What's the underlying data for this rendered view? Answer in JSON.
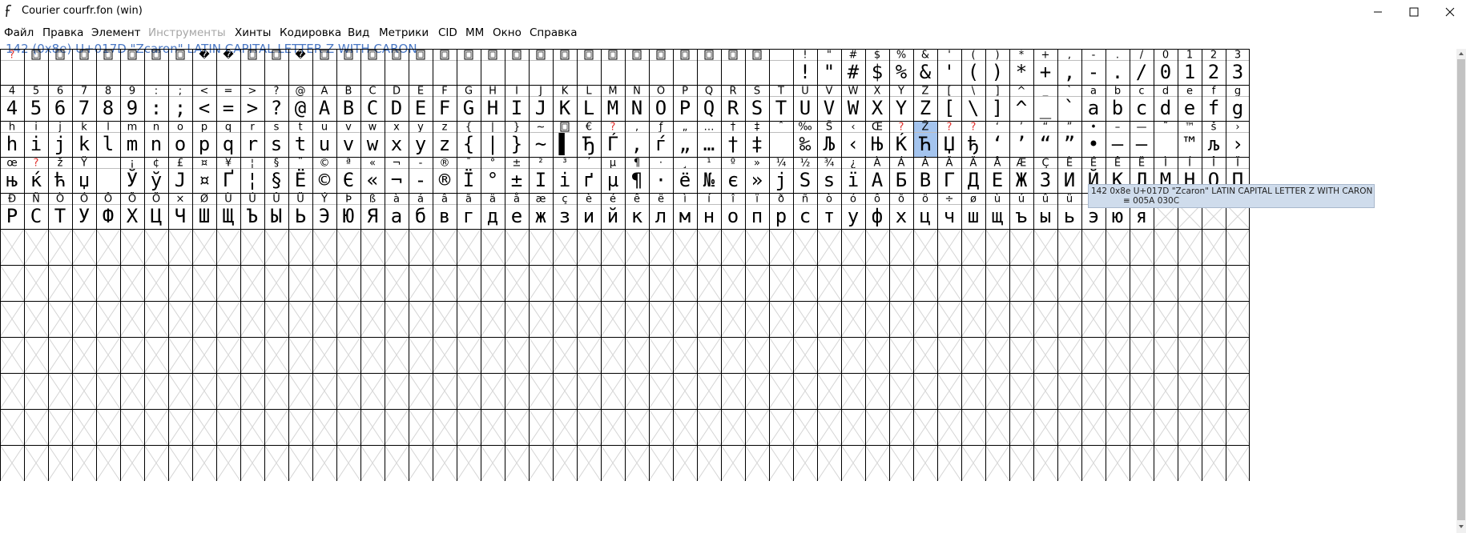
{
  "window": {
    "title": "Courier courfr.fon (win)"
  },
  "menu": [
    {
      "label": "Файл",
      "enabled": true
    },
    {
      "label": "Правка",
      "enabled": true
    },
    {
      "label": "Элемент",
      "enabled": true
    },
    {
      "label": "Инструменты",
      "enabled": false
    },
    {
      "label": "Хинты",
      "enabled": true
    },
    {
      "label": "Кодировка",
      "enabled": true
    },
    {
      "label": "Вид",
      "enabled": true
    },
    {
      "label": "Метрики",
      "enabled": true
    },
    {
      "label": "CID",
      "enabled": true
    },
    {
      "label": "MM",
      "enabled": true
    },
    {
      "label": "Окно",
      "enabled": true
    },
    {
      "label": "Справка",
      "enabled": true
    }
  ],
  "glyph_info": "142 (0x8e) U+017D \"Zcaron\" LATIN CAPITAL LETTER Z WITH CARON",
  "tooltip": {
    "line1": "142 0x8e U+017D \"Zcaron\" LATIN CAPITAL LETTER Z WITH CARON",
    "line2": "≡ 005A 030C"
  },
  "selected_index": 142,
  "colors": {
    "accent": "#4a78c4",
    "missing": "#e0302c",
    "selection": "#a4c4ee",
    "grid": "#000000",
    "empty_cross": "#d4d4d4"
  },
  "rows": [
    {
      "labels": [
        "?",
        "⌂",
        "⌂",
        "⌂",
        "⌂",
        "⌂",
        "⌂",
        "⌂",
        "�",
        "�",
        "⌂",
        "⌂",
        "�",
        "⌂",
        "⌂",
        "⌂",
        "⌂",
        "⌂",
        "⌂",
        "⌂",
        "⌂",
        "⌂",
        "⌂",
        "⌂",
        "⌂",
        "⌂",
        "⌂",
        "⌂",
        "⌂",
        "⌂",
        "⌂",
        "⌂",
        "␣",
        "!",
        "\"",
        "#",
        "$",
        "%",
        "&",
        "'",
        "(",
        ")",
        "*",
        "+",
        ",",
        "-",
        ".",
        "/",
        "0",
        "1",
        "2",
        "3"
      ],
      "glyphs": [
        "",
        "",
        "",
        "",
        "",
        "",
        "",
        "",
        "",
        "",
        "",
        "",
        "",
        "",
        "",
        "",
        "",
        "",
        "",
        "",
        "",
        "",
        "",
        "",
        "",
        "",
        "",
        "",
        "",
        "",
        "",
        "",
        "",
        "!",
        "\"",
        "#",
        "$",
        "%",
        "&",
        "'",
        "(",
        ")",
        "*",
        "+",
        ",",
        "-",
        ".",
        "/",
        "0",
        "1",
        "2",
        "3"
      ]
    },
    {
      "labels": [
        "4",
        "5",
        "6",
        "7",
        "8",
        "9",
        ":",
        ";",
        "<",
        "=",
        ">",
        "?",
        "@",
        "A",
        "B",
        "C",
        "D",
        "E",
        "F",
        "G",
        "H",
        "I",
        "J",
        "K",
        "L",
        "M",
        "N",
        "O",
        "P",
        "Q",
        "R",
        "S",
        "T",
        "U",
        "V",
        "W",
        "X",
        "Y",
        "Z",
        "[",
        "\\",
        "]",
        "^",
        "_",
        "`",
        "a",
        "b",
        "c",
        "d",
        "e",
        "f",
        "g"
      ],
      "glyphs": [
        "4",
        "5",
        "6",
        "7",
        "8",
        "9",
        ":",
        ";",
        "<",
        "=",
        ">",
        "?",
        "@",
        "A",
        "B",
        "C",
        "D",
        "E",
        "F",
        "G",
        "H",
        "I",
        "J",
        "K",
        "L",
        "M",
        "N",
        "O",
        "P",
        "Q",
        "R",
        "S",
        "T",
        "U",
        "V",
        "W",
        "X",
        "Y",
        "Z",
        "[",
        "\\",
        "]",
        "^",
        "_",
        "`",
        "a",
        "b",
        "c",
        "d",
        "e",
        "f",
        "g"
      ]
    },
    {
      "labels": [
        "h",
        "i",
        "j",
        "k",
        "l",
        "m",
        "n",
        "o",
        "p",
        "q",
        "r",
        "s",
        "t",
        "u",
        "v",
        "w",
        "x",
        "y",
        "z",
        "{",
        "|",
        "}",
        "~",
        "⌂",
        "€",
        "?",
        "‚",
        "ƒ",
        "„",
        "…",
        "†",
        "‡",
        "ˆ",
        "‰",
        "Š",
        "‹",
        "Œ",
        "?",
        "Ž",
        "?",
        "?",
        "‘",
        "’",
        "“",
        "”",
        "•",
        "–",
        "—",
        "˜",
        "™",
        "š",
        "›"
      ],
      "glyphs": [
        "h",
        "i",
        "j",
        "k",
        "l",
        "m",
        "n",
        "o",
        "p",
        "q",
        "r",
        "s",
        "t",
        "u",
        "v",
        "w",
        "x",
        "y",
        "z",
        "{",
        "|",
        "}",
        "~",
        "▌",
        "Ђ",
        "Ѓ",
        "‚",
        "ѓ",
        "„",
        "…",
        "†",
        "‡",
        "",
        "‰",
        "Љ",
        "‹",
        "Њ",
        "Ќ",
        "Ћ",
        "Џ",
        "ђ",
        "‘",
        "’",
        "“",
        "”",
        "•",
        "–",
        "—",
        "",
        "™",
        "љ",
        "›"
      ]
    },
    {
      "labels": [
        "œ",
        "?",
        "ž",
        "Ÿ",
        " ",
        "¡",
        "¢",
        "£",
        "¤",
        "¥",
        "¦",
        "§",
        "¨",
        "©",
        "ª",
        "«",
        "¬",
        "-",
        "®",
        "¯",
        "°",
        "±",
        "²",
        "³",
        "´",
        "µ",
        "¶",
        "·",
        "¸",
        "¹",
        "º",
        "»",
        "¼",
        "½",
        "¾",
        "¿",
        "À",
        "Á",
        "Â",
        "Ã",
        "Ä",
        "Å",
        "Æ",
        "Ç",
        "È",
        "É",
        "Ê",
        "Ë",
        "Ì",
        "Í",
        "Î",
        "Ï"
      ],
      "glyphs": [
        "њ",
        "ќ",
        "ћ",
        "џ",
        " ",
        "Ў",
        "ў",
        "Ј",
        "¤",
        "Ґ",
        "¦",
        "§",
        "Ё",
        "©",
        "Є",
        "«",
        "¬",
        "-",
        "®",
        "Ї",
        "°",
        "±",
        "І",
        "і",
        "ґ",
        "µ",
        "¶",
        "·",
        "ё",
        "№",
        "є",
        "»",
        "ј",
        "Ѕ",
        "ѕ",
        "ї",
        "А",
        "Б",
        "В",
        "Г",
        "Д",
        "Е",
        "Ж",
        "З",
        "И",
        "Й",
        "К",
        "Л",
        "М",
        "Н",
        "О",
        "П"
      ]
    },
    {
      "labels": [
        "Ð",
        "Ñ",
        "Ò",
        "Ó",
        "Ô",
        "Õ",
        "Ö",
        "×",
        "Ø",
        "Ù",
        "Ú",
        "Û",
        "Ü",
        "Ý",
        "Þ",
        "ß",
        "à",
        "á",
        "â",
        "ã",
        "ä",
        "å",
        "æ",
        "ç",
        "è",
        "é",
        "ê",
        "ë",
        "ì",
        "í",
        "î",
        "ï",
        "ð",
        "ñ",
        "ò",
        "ó",
        "ô",
        "õ",
        "ö",
        "÷",
        "ø",
        "ù",
        "ú",
        "û",
        "ü",
        "ý",
        "þ",
        "ÿ",
        "",
        "",
        "",
        ""
      ],
      "glyphs": [
        "Р",
        "С",
        "Т",
        "У",
        "Ф",
        "Х",
        "Ц",
        "Ч",
        "Ш",
        "Щ",
        "Ъ",
        "Ы",
        "Ь",
        "Э",
        "Ю",
        "Я",
        "а",
        "б",
        "в",
        "г",
        "д",
        "е",
        "ж",
        "з",
        "и",
        "й",
        "к",
        "л",
        "м",
        "н",
        "о",
        "п",
        "р",
        "с",
        "т",
        "у",
        "ф",
        "х",
        "ц",
        "ч",
        "ш",
        "щ",
        "ъ",
        "ы",
        "ь",
        "э",
        "ю",
        "я",
        "",
        "",
        "",
        ""
      ]
    }
  ],
  "empty_rows": 7
}
